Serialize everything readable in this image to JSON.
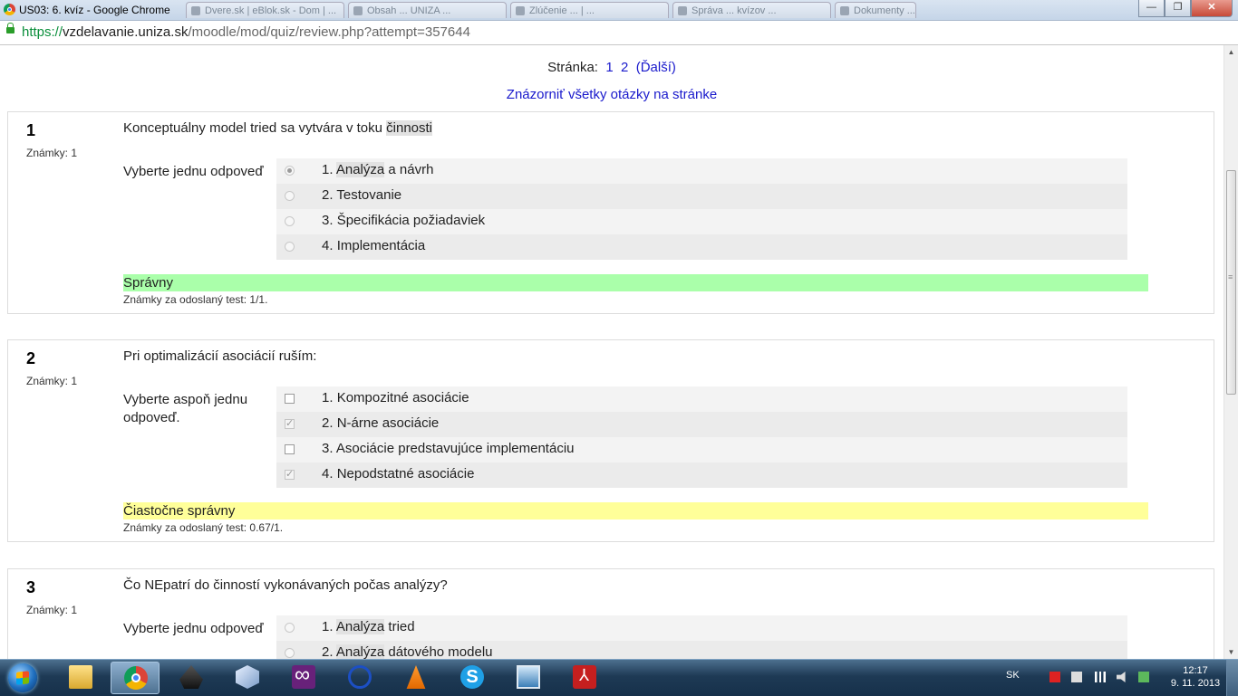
{
  "window": {
    "title": "US03: 6. kvíz - Google Chrome",
    "background_tabs": [
      "Dvere.sk | eBlok.sk - Dom | ...",
      "Obsah ... UNIZA ...",
      "Zlúčenie ... | ...",
      "Správa ... kvízov ...",
      "Dokumenty ...",
      "...",
      "..."
    ],
    "buttons": {
      "minimize": "—",
      "maximize": "❐",
      "close": "✕"
    }
  },
  "address": {
    "scheme": "https://",
    "host": "vzdelavanie.uniza.sk",
    "path": "/moodle/mod/quiz/review.php?attempt=357644"
  },
  "paging": {
    "label": "Stránka:",
    "pages": [
      "1",
      "2"
    ],
    "next": "(Ďalší)",
    "show_all": "Znázorniť všetky otázky na stránke"
  },
  "questions": [
    {
      "number": "1",
      "marks": "Známky: 1",
      "text_before": "Konceptuálny model tried sa vytvára v toku ",
      "text_highlight": "činnosti",
      "prompt": "Vyberte jednu odpoveď",
      "type": "radio",
      "options": [
        {
          "prefix": "1. ",
          "highlight": "Analýza",
          "rest": " a návrh",
          "selected": true
        },
        {
          "prefix": "2. ",
          "highlight": "",
          "rest": "Testovanie",
          "selected": false
        },
        {
          "prefix": "3. ",
          "highlight": "",
          "rest": "Špecifikácia požiadaviek",
          "selected": false
        },
        {
          "prefix": "4. ",
          "highlight": "",
          "rest": "Implementácia",
          "selected": false
        }
      ],
      "outcome": "Správny",
      "outcome_status": "correct",
      "mark_summary": "Známky za odoslaný test: 1/1."
    },
    {
      "number": "2",
      "marks": "Známky: 1",
      "text_before": "Pri optimalizácií asociácií ruším:",
      "text_highlight": "",
      "prompt": "Vyberte aspoň jednu odpoveď.",
      "type": "checkbox",
      "options": [
        {
          "prefix": "1. ",
          "highlight": "",
          "rest": "Kompozitné asociácie",
          "selected": false
        },
        {
          "prefix": "2. ",
          "highlight": "",
          "rest": "N-árne asociácie",
          "selected": true
        },
        {
          "prefix": "3. ",
          "highlight": "",
          "rest": "Asociácie predstavujúce implementáciu",
          "selected": false
        },
        {
          "prefix": "4. ",
          "highlight": "",
          "rest": "Nepodstatné asociácie",
          "selected": true
        }
      ],
      "outcome": "Čiastočne správny",
      "outcome_status": "partial",
      "mark_summary": "Známky za odoslaný test: 0.67/1."
    },
    {
      "number": "3",
      "marks": "Známky: 1",
      "text_before": "Čo NEpatrí do činností vykonávaných počas analýzy?",
      "text_highlight": "",
      "prompt": "Vyberte jednu odpoveď",
      "type": "radio",
      "options": [
        {
          "prefix": "1. ",
          "highlight": "Analýza",
          "rest": " tried",
          "selected": false
        },
        {
          "prefix": "2. ",
          "highlight": "Analýza",
          "rest": " dátového modelu",
          "selected": false
        }
      ]
    }
  ],
  "colors": {
    "correct_bg": "#aaffaa",
    "partial_bg": "#ffff99",
    "link": "#1a1acc"
  },
  "taskbar": {
    "apps": [
      "explorer-icon",
      "chrome-icon",
      "inkscape-icon",
      "virtualbox-icon",
      "visual-studio-icon",
      "network-icon",
      "vlc-icon",
      "skype-icon",
      "remote-desktop-icon",
      "acrobat-icon"
    ],
    "language": "SK",
    "time": "12:17",
    "date": "9. 11. 2013"
  }
}
